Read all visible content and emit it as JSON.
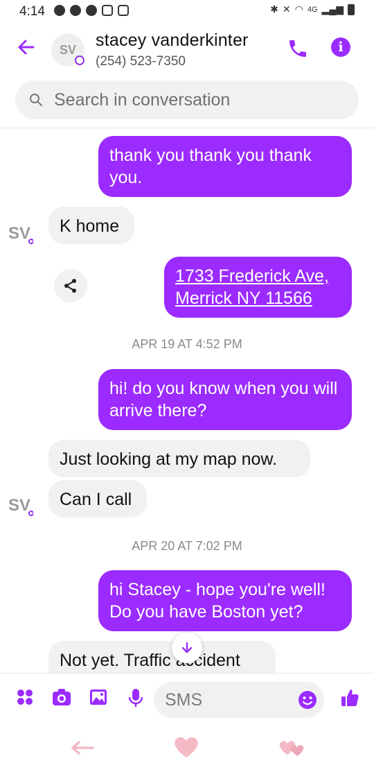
{
  "status_bar": {
    "time": "4:14",
    "network": "4G"
  },
  "header": {
    "avatar_initials": "SV",
    "contact_name": "stacey vanderkinter",
    "contact_phone": "(254) 523-7350"
  },
  "search": {
    "placeholder": "Search in conversation"
  },
  "messages": {
    "m1": {
      "text": "thank you thank you thank you."
    },
    "m2": {
      "text": "K home"
    },
    "m3": {
      "line1": "1733 Frederick Ave,",
      "line2": "Merrick NY 11566"
    },
    "date1": "APR 19 AT 4:52 PM",
    "m4": {
      "text": "hi! do you know when you will arrive there?"
    },
    "m5": {
      "text": "Just looking at my map now."
    },
    "m6": {
      "text": "Can I call"
    },
    "date2": "APR 20 AT 7:02 PM",
    "m7": {
      "text": "hi Stacey - hope you're well! Do you have Boston yet?"
    },
    "m8": {
      "text": "Not yet.  Traffic accident"
    }
  },
  "composer": {
    "placeholder": "SMS"
  },
  "colors": {
    "accent": "#9b2bff",
    "incoming_bubble": "#f1f1f1"
  },
  "icons": {
    "back": "arrow-left-icon",
    "call": "phone-icon",
    "info": "info-icon",
    "search": "search-icon",
    "share": "share-icon",
    "apps": "apps-icon",
    "camera": "camera-icon",
    "gallery": "image-icon",
    "mic": "mic-icon",
    "emoji": "emoji-icon",
    "like": "thumbs-up-icon",
    "scroll": "arrow-down-icon"
  }
}
